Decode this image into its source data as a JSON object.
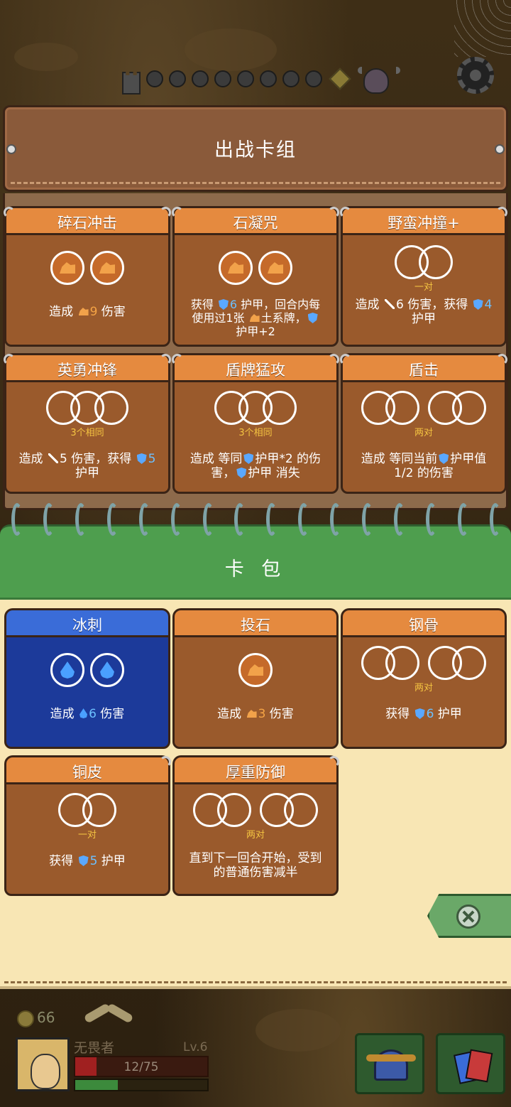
{
  "deck": {
    "title": "出战卡组",
    "cards": [
      {
        "name": "碎石冲击",
        "desc_pre": "造成 ",
        "value": "9",
        "desc_post": " 伤害"
      },
      {
        "name": "石凝咒",
        "line1_pre": "获得 ",
        "value": "6",
        "line1_post": " 护甲，回合内每",
        "line2": "使用过1张 ",
        "line2_post": "土系牌，",
        "line3": "护甲+2"
      },
      {
        "name": "野蛮冲撞+",
        "slot_label": "一对",
        "line1_pre": "造成 ",
        "dmg": "6",
        "line1_mid": " 伤害，获得 ",
        "armor": "4",
        "line2": "护甲"
      },
      {
        "name": "英勇冲锋",
        "slot_label": "3个相同",
        "line1_pre": "造成 ",
        "dmg": "5",
        "line1_mid": " 伤害，获得 ",
        "armor": "5",
        "line2": "护甲"
      },
      {
        "name": "盾牌猛攻",
        "slot_label": "3个相同",
        "line1_pre": "造成 等同",
        "line1_post": "护甲*2 的伤",
        "line2_pre": "害，",
        "line2_post": "护甲 消失"
      },
      {
        "name": "盾击",
        "slot_label": "两对",
        "line1_pre": "造成 等同当前",
        "line1_post": "护甲值",
        "line2": "1/2 的伤害"
      }
    ]
  },
  "pack": {
    "title": "卡 包",
    "cards": [
      {
        "name": "冰刺",
        "desc_pre": "造成 ",
        "value": "6",
        "desc_post": " 伤害"
      },
      {
        "name": "投石",
        "desc_pre": "造成 ",
        "value": "3",
        "desc_post": " 伤害"
      },
      {
        "name": "钢骨",
        "slot_label": "两对",
        "desc_pre": "获得 ",
        "value": "6",
        "desc_post": " 护甲"
      },
      {
        "name": "铜皮",
        "slot_label": "一对",
        "desc_pre": "获得 ",
        "value": "5",
        "desc_post": " 护甲"
      },
      {
        "name": "厚重防御",
        "slot_label": "两对",
        "line1": "直到下一回合开始，受到",
        "line2": "的普通伤害减半"
      }
    ]
  },
  "player": {
    "coins": "66",
    "name": "无畏者",
    "level": "Lv.6",
    "hp_text": "12/75",
    "hp_fraction": 0.16,
    "xp_fraction": 0.32
  },
  "colors": {
    "card_orange": "#e58a3f",
    "card_brown": "#9a5a2c",
    "card_blue_tab": "#3a6cd8",
    "card_blue_face": "#1c3a9a",
    "pack_green": "#4e9e4e",
    "pack_bg": "#f8e6b4",
    "armor_blue": "#5aa8ff",
    "earth_orange": "#f2a24a"
  }
}
